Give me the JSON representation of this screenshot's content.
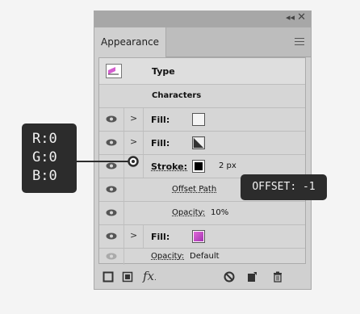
{
  "panel": {
    "tab": "Appearance",
    "header": {
      "type_label": "Type",
      "characters_label": "Characters"
    },
    "rows": [
      {
        "label": "Fill:",
        "swatch_color": "#f4f4f4"
      },
      {
        "label": "Fill:",
        "swatch_color": "#444444"
      },
      {
        "label": "Stroke:",
        "value": "2 px",
        "swatch_color": "#000000"
      },
      {
        "label": "Offset Path"
      },
      {
        "label": "Opacity:",
        "value": "10%"
      },
      {
        "label": "Fill:",
        "swatch_color": "#c34fc9"
      },
      {
        "label": "Opacity:",
        "value": "Default"
      }
    ],
    "bottom_icons": [
      "new-art-stroke-icon",
      "new-art-fill-icon",
      "fx-icon",
      "clear-icon",
      "duplicate-icon",
      "delete-icon"
    ]
  },
  "callouts": {
    "rgb": [
      "R:0",
      "G:0",
      "B:0"
    ],
    "offset": "OFFSET: -1"
  },
  "colors": {
    "accent_purple": "#c34fc9",
    "callout_bg": "#2c2c2c"
  }
}
